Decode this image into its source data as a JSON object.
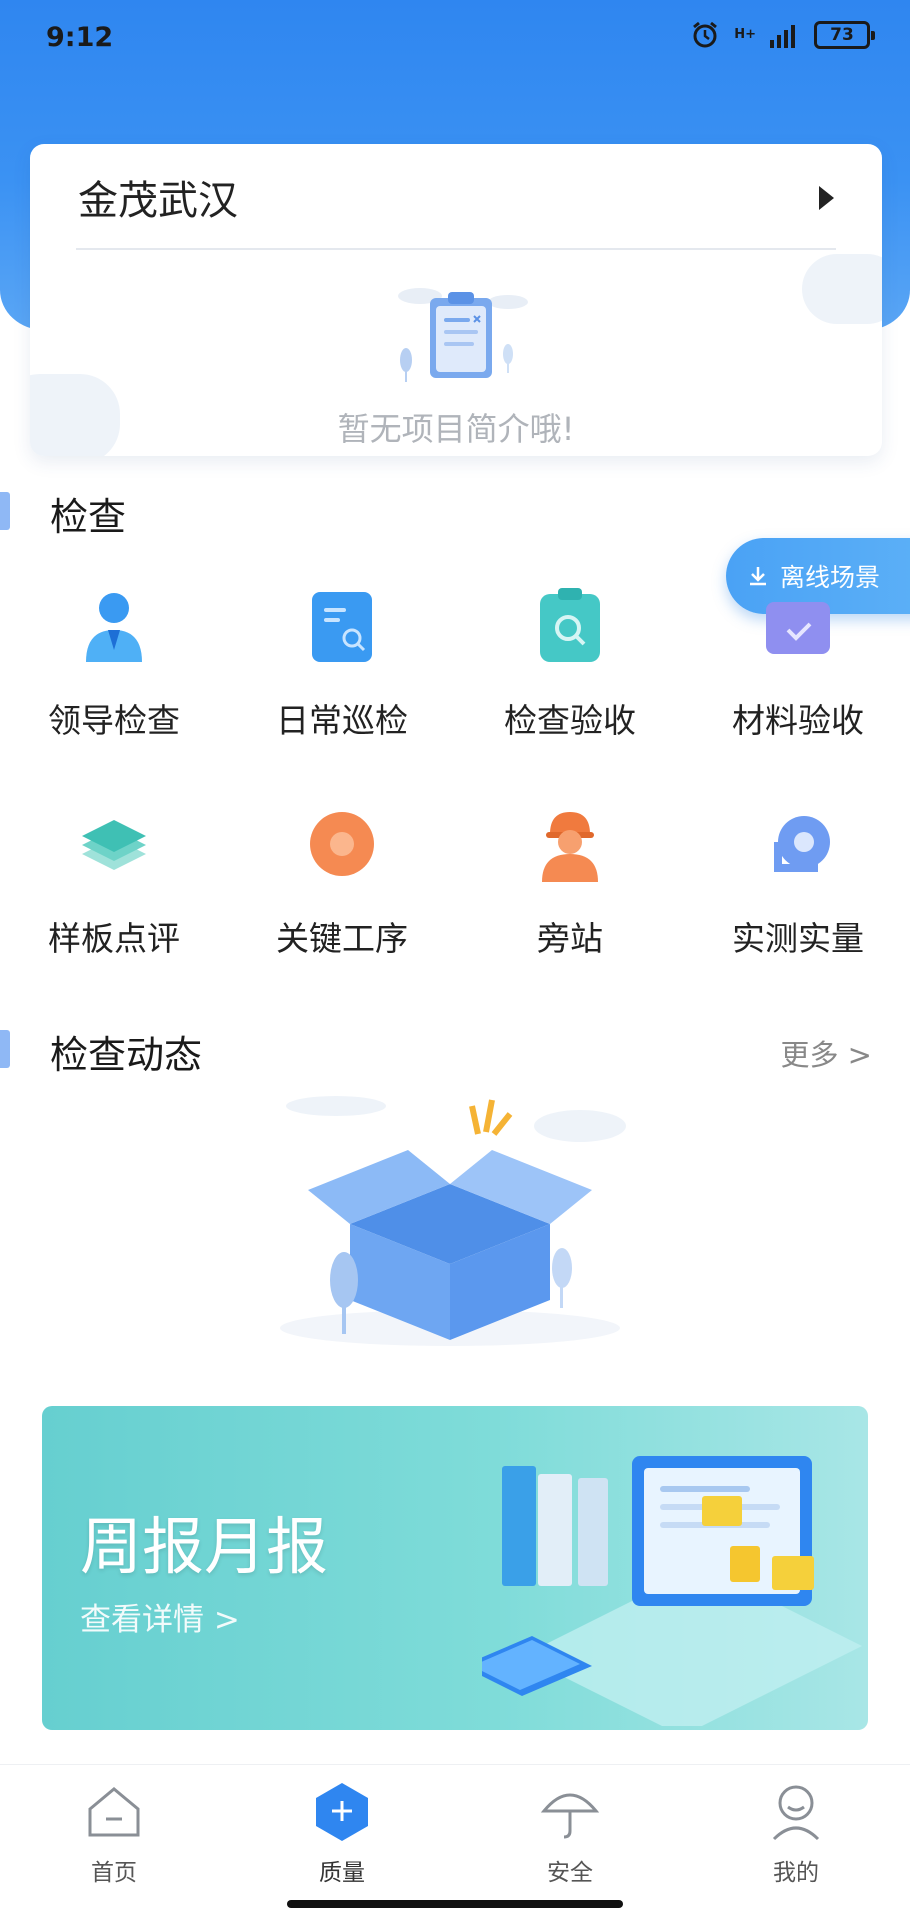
{
  "status_bar": {
    "time": "9:12",
    "signal": "H+",
    "battery": "73"
  },
  "project": {
    "title": "金茂武汉",
    "empty_text": "暂无项目简介哦!"
  },
  "inspection": {
    "title": "检查",
    "offline_label": "离线场景",
    "items": [
      {
        "label": "领导检查",
        "icon": "leader-inspection-icon"
      },
      {
        "label": "日常巡检",
        "icon": "daily-patrol-icon"
      },
      {
        "label": "检查验收",
        "icon": "acceptance-check-icon"
      },
      {
        "label": "材料验收",
        "icon": "material-acceptance-icon"
      },
      {
        "label": "样板点评",
        "icon": "sample-review-icon"
      },
      {
        "label": "关键工序",
        "icon": "key-process-icon"
      },
      {
        "label": "旁站",
        "icon": "site-supervision-icon"
      },
      {
        "label": "实测实量",
        "icon": "measurement-icon"
      }
    ]
  },
  "feed": {
    "title": "检查动态",
    "more": "更多 >"
  },
  "banner": {
    "title": "周报月报",
    "link": "查看详情 >"
  },
  "tabs": [
    {
      "label": "首页",
      "icon": "home-icon"
    },
    {
      "label": "质量",
      "icon": "quality-icon"
    },
    {
      "label": "安全",
      "icon": "umbrella-icon"
    },
    {
      "label": "我的",
      "icon": "profile-icon"
    }
  ],
  "colors": {
    "primary": "#2f86f0",
    "banner": "#7fdcd9",
    "accent_orange": "#f58a52"
  }
}
